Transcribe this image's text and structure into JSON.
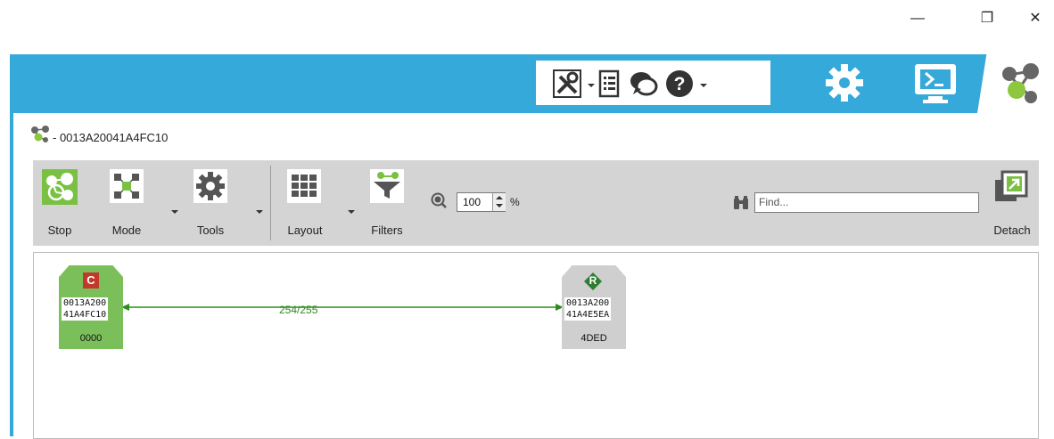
{
  "window": {
    "minimize_icon": "minimize-icon",
    "restore_icon": "restore-icon",
    "close_icon": "close-icon",
    "minimize_glyph": "—",
    "restore_glyph": "❐",
    "close_glyph": "✕"
  },
  "header": {
    "band_color": "#35a9d9",
    "tools_icon": "tools-icon",
    "list_icon": "list-icon",
    "chat_icon": "chat-icon",
    "help_icon": "help-icon",
    "settings_icon": "gear-icon",
    "console_icon": "console-icon",
    "network_icon": "network-icon"
  },
  "page": {
    "title": "- 0013A20041A4FC10"
  },
  "toolbar": {
    "stop_label": "Stop",
    "mode_label": "Mode",
    "tools_label": "Tools",
    "layout_label": "Layout",
    "filters_label": "Filters",
    "detach_label": "Detach",
    "zoom_value": "100",
    "zoom_unit": "%",
    "find_placeholder": "Find..."
  },
  "graph": {
    "link_label": "254/255",
    "link_color": "#2e8b1f",
    "nodes": [
      {
        "role": "C",
        "id_line1": "0013A200",
        "id_line2": "41A4FC10",
        "net_addr": "0000",
        "color": "#7bbf5a",
        "badge_color": "#c0392b"
      },
      {
        "role": "R",
        "id_line1": "0013A200",
        "id_line2": "41A4E5EA",
        "net_addr": "4DED",
        "color": "#cfcfcf",
        "badge_color": "#2e7d32"
      }
    ]
  }
}
